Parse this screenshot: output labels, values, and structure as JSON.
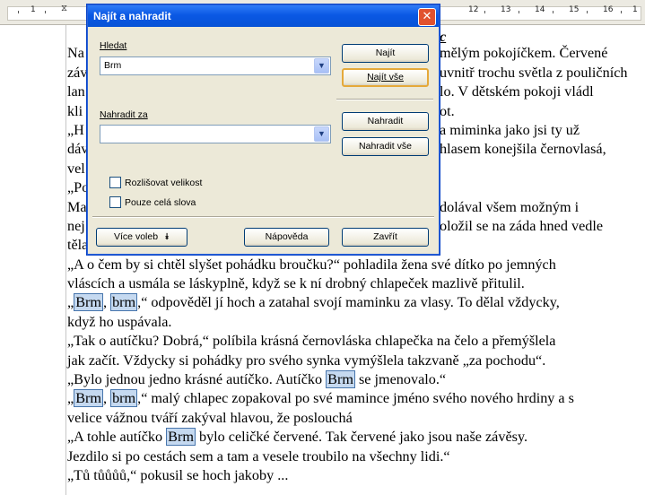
{
  "ruler": {
    "numbers": [
      "1",
      "12",
      "13",
      "14",
      "15",
      "16",
      "1"
    ]
  },
  "dialog": {
    "title": "Najít a nahradit",
    "close_glyph": "✕",
    "search_label": "Hledat",
    "search_value": "Brm",
    "replace_label": "Nahradit za",
    "replace_value": "",
    "find_button": "Najít",
    "find_all_button": "Najít vše",
    "replace_button": "Nahradit",
    "replace_all_button": "Nahradit vše",
    "match_case_label": "Rozlišovat velikost",
    "whole_words_label": "Pouze celá slova",
    "more_options_button": "Více voleb",
    "help_button": "Nápověda",
    "close_button": "Zavřít"
  },
  "document": {
    "heading_fragment": "c",
    "right_column": [
      "mělým pokojíčkem. Červené",
      "uvnitř trochu světla z pouličních",
      "lo. V dětském pokoji vládl",
      "ot.",
      "a miminka jako jsi ty už",
      "hlasem konejšila černovlasá,",
      "",
      "",
      "dolával všem možným i",
      "oložil se na záda hned vedle"
    ],
    "left_column": [
      "Na",
      "záv",
      "lan",
      "kli",
      "„H",
      "dáv",
      "vel",
      "„Po",
      "Ma",
      "nej"
    ],
    "lines": [
      {
        "pre": "těla své maminky a toužebně se na ni zahleděl.",
        "hl": "",
        "post": ""
      },
      {
        "pre": "„A o čem by si chtěl slyšet pohádku broučku?“ pohladila žena své dítko po jemných",
        "hl": "",
        "post": ""
      },
      {
        "pre": "vláscích a usmála se láskyplně, když se k ní drobný chlapeček mazlivě přitulil.",
        "hl": "",
        "post": ""
      },
      {
        "pre": "„",
        "hl": "Brm",
        "mid": ", ",
        "hl2": "brm",
        "post": ",“ odpověděl jí hoch a zatahal svojí maminku za vlasy. To dělal vždycky,"
      },
      {
        "pre": "když ho uspávala.",
        "hl": "",
        "post": ""
      },
      {
        "pre": "„Tak o autíčku? Dobrá,“ políbila krásná černovláska chlapečka na čelo a přemýšlela",
        "hl": "",
        "post": ""
      },
      {
        "pre": "jak začít. Vždycky si pohádky pro svého synka vymýšlela takzvaně „za pochodu“.",
        "hl": "",
        "post": ""
      },
      {
        "pre": "„Bylo jednou jedno krásné autíčko. Autíčko ",
        "hl": "Brm",
        "post": " se jmenovalo.“"
      },
      {
        "pre": "„",
        "hl": "Brm",
        "mid": ", ",
        "hl2": "brm",
        "post": ",“ malý chlapec zopakoval po své mamince jméno svého nového hrdiny a s"
      },
      {
        "pre": "velice vážnou tváří zakýval hlavou, že poslouchá",
        "hl": "",
        "post": ""
      },
      {
        "pre": "„A tohle autíčko ",
        "hl": "Brm",
        "post": " bylo celičké červené. Tak červené jako jsou naše závěsy."
      },
      {
        "pre": "Jezdilo si po cestách sem a tam a vesele troubilo na všechny lidi.“",
        "hl": "",
        "post": ""
      },
      {
        "pre": "„Tů tůůůů,“ pokusil se hoch jakoby ...",
        "hl": "",
        "post": ""
      }
    ]
  }
}
